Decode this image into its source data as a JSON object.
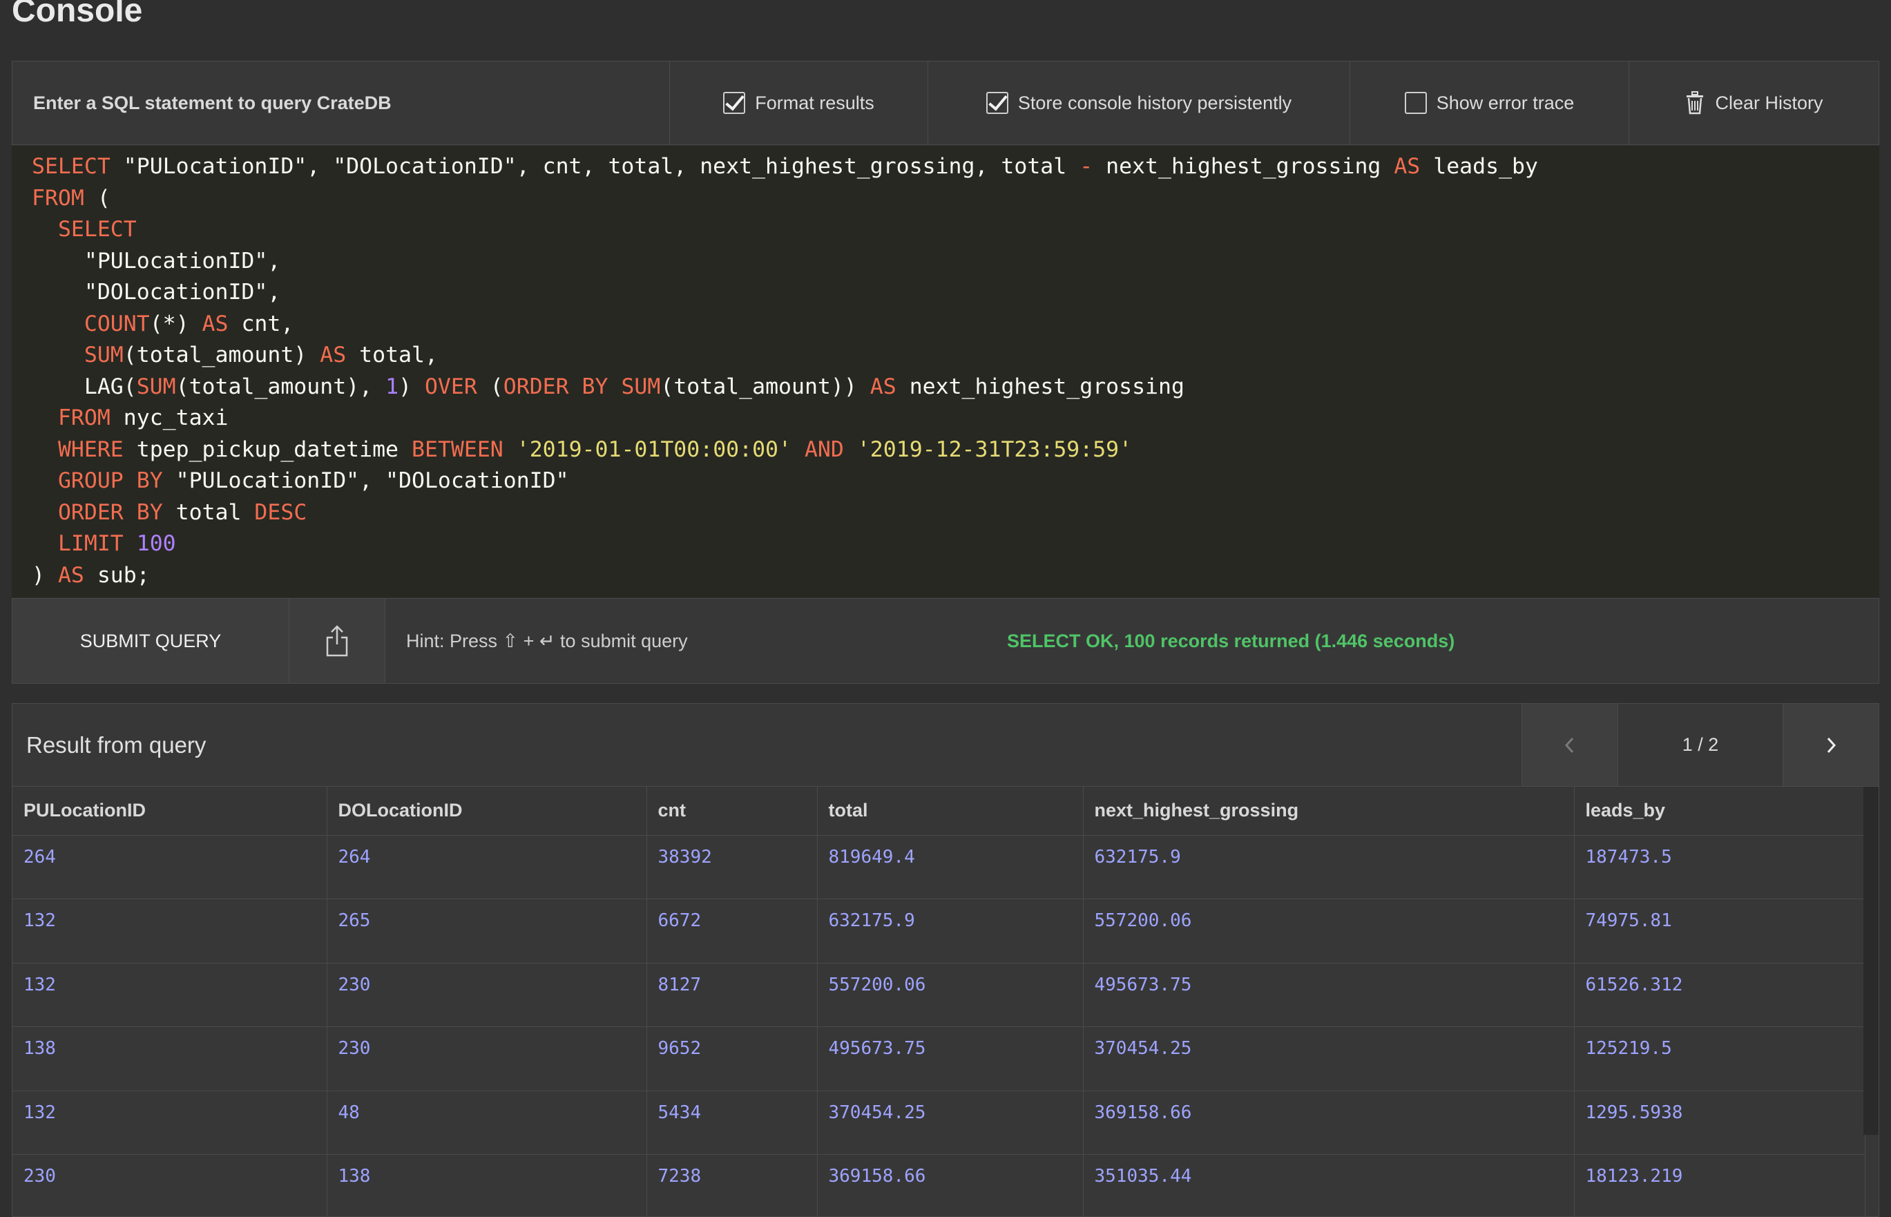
{
  "page": {
    "title": "Console"
  },
  "toolbar": {
    "prompt": "Enter a SQL statement to query CrateDB",
    "format_results": {
      "label": "Format results",
      "checked": true
    },
    "store_history": {
      "label": "Store console history persistently",
      "checked": true
    },
    "show_error_trace": {
      "label": "Show error trace",
      "checked": false
    },
    "clear_history": {
      "label": "Clear History",
      "icon": "trash-icon"
    }
  },
  "editor": {
    "lines": [
      [
        [
          "kw",
          "SELECT"
        ],
        [
          "id",
          " \"PULocationID\", \"DOLocationID\", cnt, total, next_highest_grossing, total "
        ],
        [
          "kw",
          "-"
        ],
        [
          "id",
          " next_highest_grossing "
        ],
        [
          "kw",
          "AS"
        ],
        [
          "id",
          " leads_by"
        ]
      ],
      [
        [
          "kw",
          "FROM"
        ],
        [
          "id",
          " ("
        ]
      ],
      [
        [
          "id",
          "  "
        ],
        [
          "kw",
          "SELECT"
        ]
      ],
      [
        [
          "id",
          "    \"PULocationID\","
        ]
      ],
      [
        [
          "id",
          "    \"DOLocationID\","
        ]
      ],
      [
        [
          "id",
          "    "
        ],
        [
          "kw",
          "COUNT"
        ],
        [
          "id",
          "(*) "
        ],
        [
          "kw",
          "AS"
        ],
        [
          "id",
          " cnt,"
        ]
      ],
      [
        [
          "id",
          "    "
        ],
        [
          "kw",
          "SUM"
        ],
        [
          "id",
          "(total_amount) "
        ],
        [
          "kw",
          "AS"
        ],
        [
          "id",
          " total,"
        ]
      ],
      [
        [
          "id",
          "    LAG("
        ],
        [
          "kw",
          "SUM"
        ],
        [
          "id",
          "(total_amount), "
        ],
        [
          "num",
          "1"
        ],
        [
          "id",
          ") "
        ],
        [
          "kw",
          "OVER"
        ],
        [
          "id",
          " ("
        ],
        [
          "kw",
          "ORDER BY"
        ],
        [
          "id",
          " "
        ],
        [
          "kw",
          "SUM"
        ],
        [
          "id",
          "(total_amount)) "
        ],
        [
          "kw",
          "AS"
        ],
        [
          "id",
          " next_highest_grossing"
        ]
      ],
      [
        [
          "id",
          "  "
        ],
        [
          "kw",
          "FROM"
        ],
        [
          "id",
          " nyc_taxi"
        ]
      ],
      [
        [
          "id",
          "  "
        ],
        [
          "kw",
          "WHERE"
        ],
        [
          "id",
          " tpep_pickup_datetime "
        ],
        [
          "kw",
          "BETWEEN"
        ],
        [
          "id",
          " "
        ],
        [
          "str",
          "'2019-01-01T00:00:00'"
        ],
        [
          "id",
          " "
        ],
        [
          "kw",
          "AND"
        ],
        [
          "id",
          " "
        ],
        [
          "str",
          "'2019-12-31T23:59:59'"
        ]
      ],
      [
        [
          "id",
          "  "
        ],
        [
          "kw",
          "GROUP BY"
        ],
        [
          "id",
          " \"PULocationID\", \"DOLocationID\""
        ]
      ],
      [
        [
          "id",
          "  "
        ],
        [
          "kw",
          "ORDER BY"
        ],
        [
          "id",
          " total "
        ],
        [
          "kw",
          "DESC"
        ]
      ],
      [
        [
          "id",
          "  "
        ],
        [
          "kw",
          "LIMIT"
        ],
        [
          "id",
          " "
        ],
        [
          "num",
          "100"
        ]
      ],
      [
        [
          "id",
          ") "
        ],
        [
          "kw",
          "AS"
        ],
        [
          "id",
          " sub;"
        ]
      ]
    ],
    "colors": {
      "keyword": "#f26d50",
      "number": "#ae81ff",
      "string": "#e6db74",
      "text": "#f8f8f2",
      "background": "#272822"
    }
  },
  "submit": {
    "button_label": "SUBMIT QUERY",
    "share_icon": "share-icon",
    "hint": "Hint: Press ⇧ + ↵ to submit query",
    "status": "SELECT OK, 100 records returned (1.446 seconds)",
    "status_color": "#4fc466"
  },
  "results": {
    "title": "Result from query",
    "pager": {
      "label": "1 / 2",
      "prev_icon": "chevron-left-icon",
      "next_icon": "chevron-right-icon"
    },
    "columns": [
      "PULocationID",
      "DOLocationID",
      "cnt",
      "total",
      "next_highest_grossing",
      "leads_by"
    ],
    "rows": [
      [
        "264",
        "264",
        "38392",
        "819649.4",
        "632175.9",
        "187473.5"
      ],
      [
        "132",
        "265",
        "6672",
        "632175.9",
        "557200.06",
        "74975.81"
      ],
      [
        "132",
        "230",
        "8127",
        "557200.06",
        "495673.75",
        "61526.312"
      ],
      [
        "138",
        "230",
        "9652",
        "495673.75",
        "370454.25",
        "125219.5"
      ],
      [
        "132",
        "48",
        "5434",
        "370454.25",
        "369158.66",
        "1295.5938"
      ],
      [
        "230",
        "138",
        "7238",
        "369158.66",
        "351035.44",
        "18123.219"
      ]
    ]
  }
}
